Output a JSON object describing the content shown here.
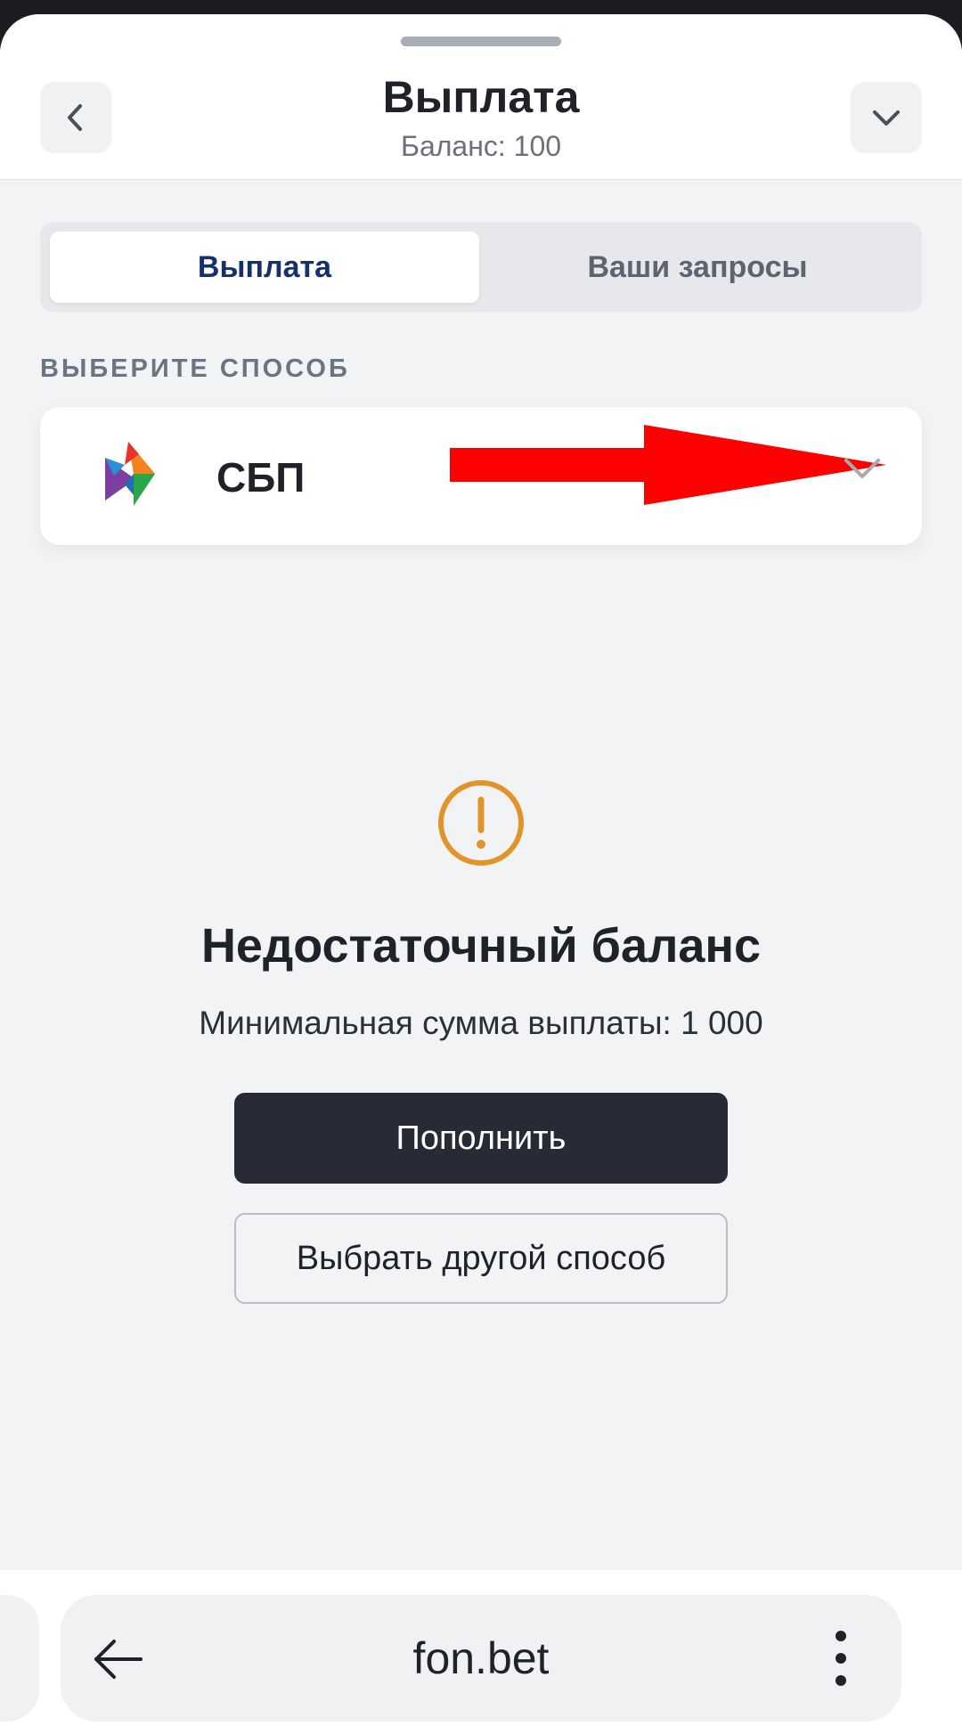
{
  "header": {
    "title": "Выплата",
    "balance": "Баланс: 100",
    "back_icon": "chevron-left-icon",
    "collapse_icon": "chevron-down-icon"
  },
  "tabs": [
    {
      "label": "Выплата",
      "active": true
    },
    {
      "label": "Ваши запросы",
      "active": false
    }
  ],
  "method_section": {
    "label": "ВЫБЕРИТЕ СПОСОБ",
    "selected": {
      "name": "СБП",
      "icon": "sbp-logo-icon",
      "dropdown_icon": "chevron-down-icon"
    },
    "annotation": "red-arrow-icon"
  },
  "empty_state": {
    "icon": "warning-circle-icon",
    "title": "Недостаточный баланс",
    "subtitle": "Минимальная сумма выплаты: 1 000",
    "primary_button": "Пополнить",
    "secondary_button": "Выбрать другой способ"
  },
  "browser": {
    "url": "fon.bet",
    "back_icon": "arrow-left-icon",
    "menu_icon": "more-vertical-icon"
  },
  "colors": {
    "accent_tab_text": "#16306e",
    "primary_button": "#262b36",
    "warning": "#e0952a",
    "annotation_arrow": "#ff0000"
  }
}
